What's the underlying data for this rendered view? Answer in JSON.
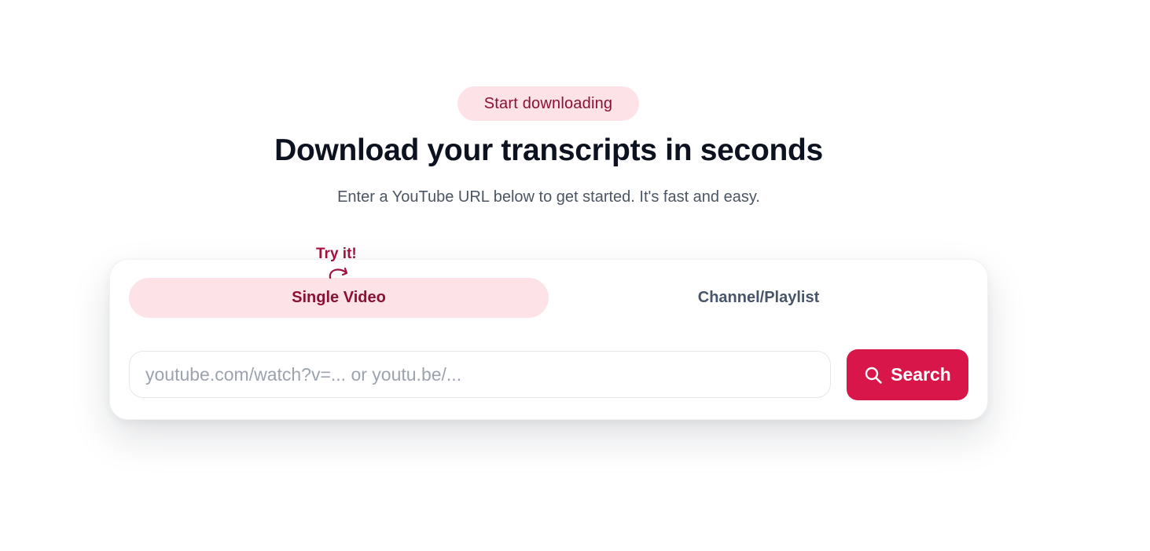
{
  "hero": {
    "badge": "Start downloading",
    "title": "Download your transcripts in seconds",
    "subtitle": "Enter a YouTube URL below to get started. It's fast and easy."
  },
  "card": {
    "hint": "Try it!",
    "tabs": [
      {
        "label": "Single Video",
        "active": true
      },
      {
        "label": "Channel/Playlist",
        "active": false
      }
    ],
    "input": {
      "value": "",
      "placeholder": "youtube.com/watch?v=... or youtu.be/..."
    },
    "search_button": {
      "label": "Search",
      "icon": "search-icon"
    }
  },
  "colors": {
    "accent": "#d8164a",
    "accent_dark": "#8a1034",
    "accent_soft": "#fde3e8",
    "title": "#0d1221",
    "muted": "#4b5563"
  }
}
